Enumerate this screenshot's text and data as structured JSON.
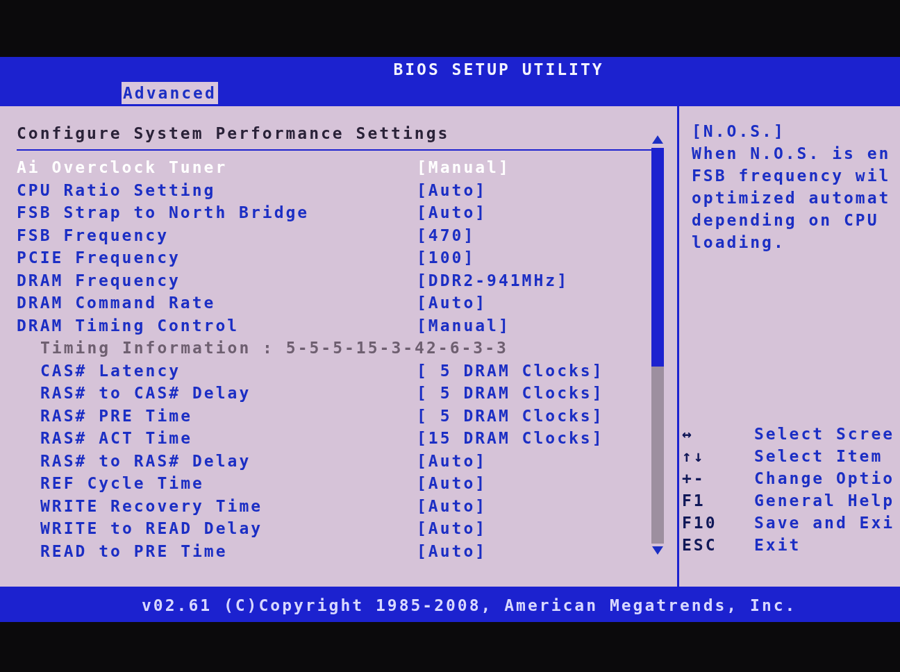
{
  "title": "BIOS SETUP UTILITY",
  "tabs": [
    {
      "label": "Advanced",
      "selected": true
    }
  ],
  "section_title": "Configure System Performance Settings",
  "settings": [
    {
      "kind": "option",
      "label": "Ai Overclock Tuner",
      "value": "[Manual]",
      "selected": true
    },
    {
      "kind": "option",
      "label": "CPU Ratio Setting",
      "value": "[Auto]",
      "selected": false
    },
    {
      "kind": "option",
      "label": "FSB Strap to North Bridge",
      "value": "[Auto]",
      "selected": false
    },
    {
      "kind": "option",
      "label": "FSB Frequency",
      "value": "[470]",
      "selected": false
    },
    {
      "kind": "option",
      "label": "PCIE Frequency",
      "value": "[100]",
      "selected": false
    },
    {
      "kind": "option",
      "label": "DRAM Frequency",
      "value": "[DDR2-941MHz]",
      "selected": false
    },
    {
      "kind": "option",
      "label": "DRAM Command Rate",
      "value": "[Auto]",
      "selected": false
    },
    {
      "kind": "option",
      "label": "DRAM Timing Control",
      "value": "[Manual]",
      "selected": false,
      "children": [
        {
          "kind": "info",
          "label": "Timing Information : 5-5-5-15-3-42-6-3-3"
        },
        {
          "kind": "option",
          "label": "CAS# Latency",
          "value": "[ 5 DRAM Clocks]",
          "selected": false
        },
        {
          "kind": "option",
          "label": "RAS# to CAS# Delay",
          "value": "[ 5 DRAM Clocks]",
          "selected": false
        },
        {
          "kind": "option",
          "label": "RAS# PRE Time",
          "value": "[ 5 DRAM Clocks]",
          "selected": false
        },
        {
          "kind": "option",
          "label": "RAS# ACT Time",
          "value": "[15 DRAM Clocks]",
          "selected": false
        },
        {
          "kind": "option",
          "label": "RAS# to RAS# Delay",
          "value": "[Auto]",
          "selected": false
        },
        {
          "kind": "option",
          "label": "REF Cycle Time",
          "value": "[Auto]",
          "selected": false
        },
        {
          "kind": "option",
          "label": "WRITE Recovery Time",
          "value": "[Auto]",
          "selected": false
        },
        {
          "kind": "option",
          "label": "WRITE to READ Delay",
          "value": "[Auto]",
          "selected": false
        },
        {
          "kind": "option",
          "label": "READ to PRE Time",
          "value": "[Auto]",
          "selected": false
        }
      ]
    }
  ],
  "help": {
    "lines": [
      "[N.O.S.]",
      "When N.O.S. is en",
      "FSB frequency wil",
      "optimized automat",
      "depending on CPU",
      "loading."
    ]
  },
  "keys": [
    {
      "key": "↔",
      "action": "Select Scree"
    },
    {
      "key": "↑↓",
      "action": "Select Item"
    },
    {
      "key": "+-",
      "action": "Change Optio"
    },
    {
      "key": "F1",
      "action": "General Help"
    },
    {
      "key": "F10",
      "action": "Save and Exi"
    },
    {
      "key": "ESC",
      "action": "Exit"
    }
  ],
  "footer": "v02.61 (C)Copyright 1985-2008, American Megatrends, Inc."
}
